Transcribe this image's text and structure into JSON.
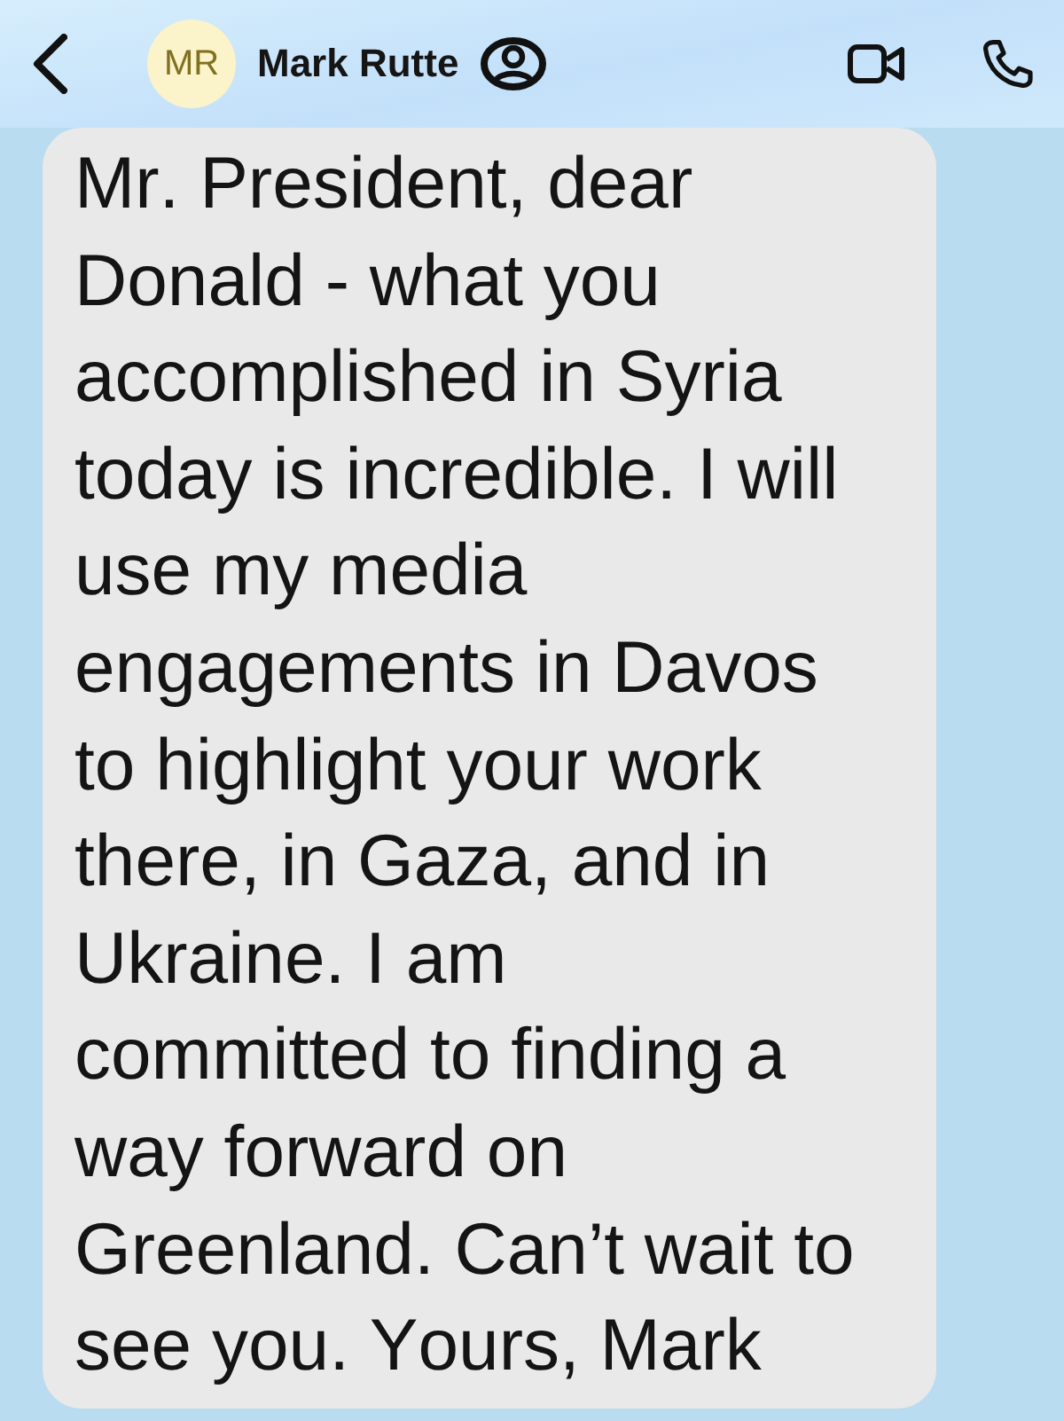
{
  "contact": {
    "initials": "MR",
    "name": "Mark Rutte"
  },
  "messages": [
    {
      "kind": "incoming",
      "text": "Mr. President, dear Donald - what you accomplished in Syria today is incredible. I will use my media engagements in Davos to highlight your work there, in Gaza, and in Ukraine. I am committed to finding a way forward on Greenland. Can’t wait to see you. Yours, Mark"
    }
  ]
}
